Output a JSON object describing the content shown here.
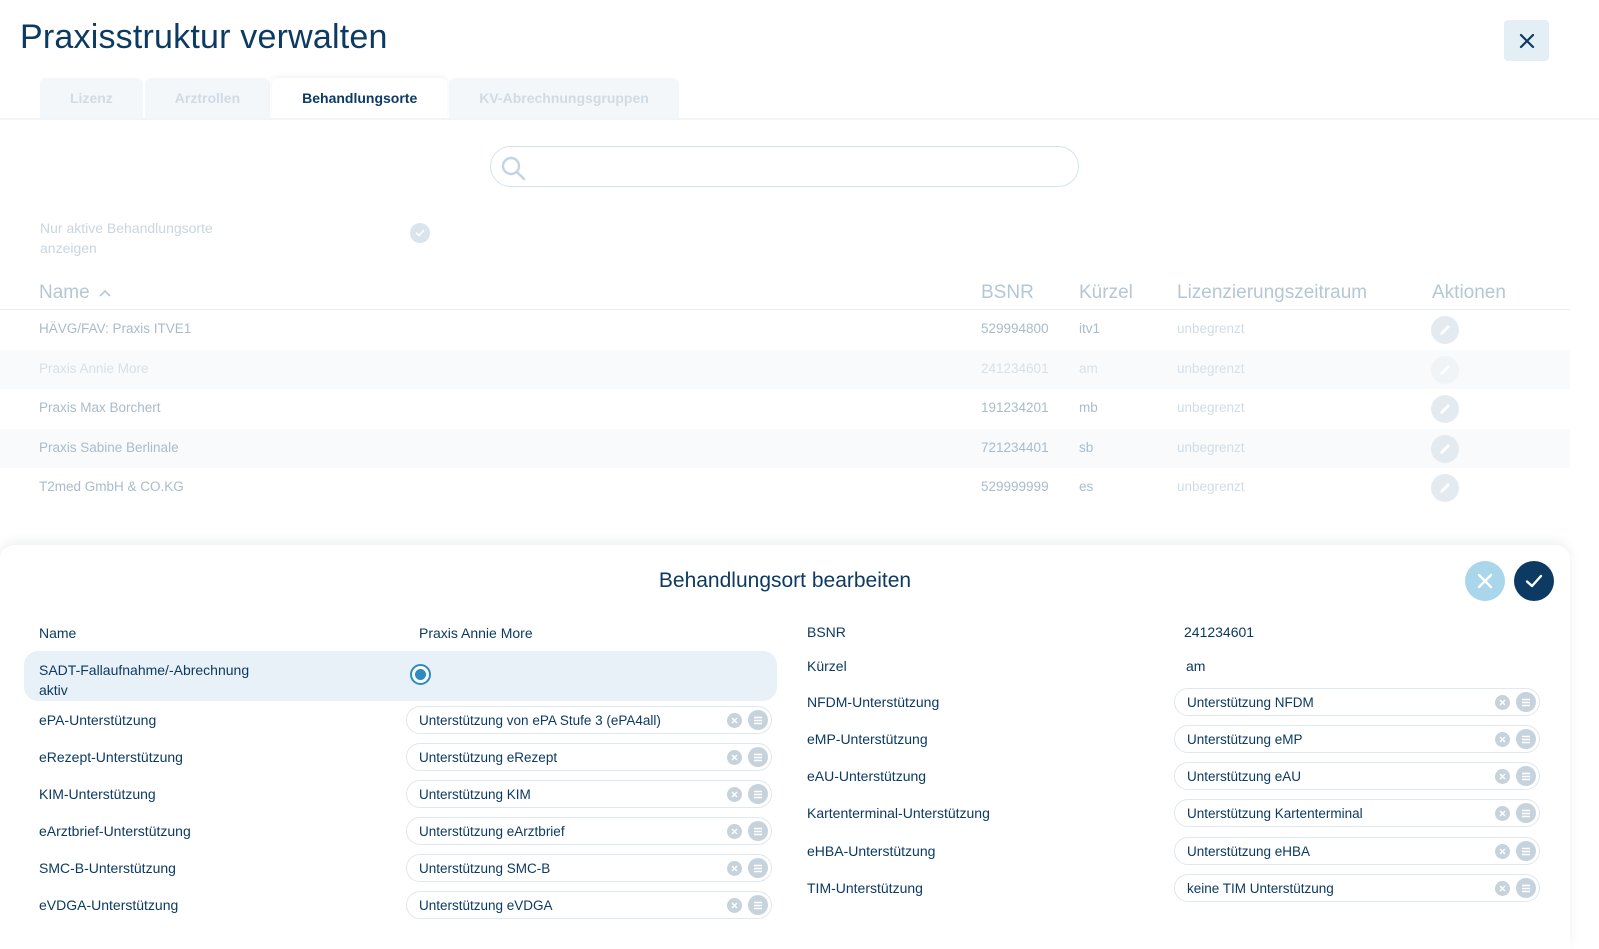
{
  "header": {
    "title": "Praxisstruktur verwalten"
  },
  "tabs": [
    {
      "label": "Lizenz"
    },
    {
      "label": "Arztrollen"
    },
    {
      "label": "Behandlungsorte"
    },
    {
      "label": "KV-Abrechnungsgruppen"
    }
  ],
  "active_tab": "Behandlungsorte",
  "search": {
    "value": "",
    "placeholder": ""
  },
  "filter": {
    "label": "Nur aktive Behandlungsorte anzeigen",
    "checked": true
  },
  "table": {
    "columns": {
      "name": "Name",
      "bsnr": "BSNR",
      "kuerzel": "Kürzel",
      "lizenz": "Lizenzierungszeitraum",
      "aktionen": "Aktionen"
    },
    "sort": "Name ascending",
    "rows": [
      {
        "name": "HÄVG/FAV: Praxis ITVE1",
        "bsnr": "529994800",
        "kuerzel": "itv1",
        "lizenz": "unbegrenzt"
      },
      {
        "name": "Praxis Annie More",
        "bsnr": "241234601",
        "kuerzel": "am",
        "lizenz": "unbegrenzt"
      },
      {
        "name": "Praxis Max Borchert",
        "bsnr": "191234201",
        "kuerzel": "mb",
        "lizenz": "unbegrenzt"
      },
      {
        "name": "Praxis Sabine Berlinale",
        "bsnr": "721234401",
        "kuerzel": "sb",
        "lizenz": "unbegrenzt"
      },
      {
        "name": "T2med GmbH & CO.KG",
        "bsnr": "529999999",
        "kuerzel": "es",
        "lizenz": "unbegrenzt"
      }
    ]
  },
  "edit_panel": {
    "title": "Behandlungsort bearbeiten",
    "left": {
      "name_label": "Name",
      "name_value": "Praxis Annie More",
      "sadt_label_1": "SADT-Fallaufnahme/-Abrechnung",
      "sadt_label_2": "aktiv",
      "sadt_checked": true,
      "fields": [
        {
          "label": "ePA-Unterstützung",
          "value": "Unterstützung von ePA Stufe 3 (ePA4all)"
        },
        {
          "label": "eRezept-Unterstützung",
          "value": "Unterstützung eRezept"
        },
        {
          "label": "KIM-Unterstützung",
          "value": "Unterstützung KIM"
        },
        {
          "label": "eArztbrief-Unterstützung",
          "value": "Unterstützung eArztbrief"
        },
        {
          "label": "SMC-B-Unterstützung",
          "value": "Unterstützung SMC-B"
        },
        {
          "label": "eVDGA-Unterstützung",
          "value": "Unterstützung eVDGA"
        }
      ]
    },
    "right": {
      "bsnr_label": "BSNR",
      "bsnr_value": "241234601",
      "kuerzel_label": "Kürzel",
      "kuerzel_value": "am",
      "fields": [
        {
          "label": "NFDM-Unterstützung",
          "value": "Unterstützung NFDM"
        },
        {
          "label": "eMP-Unterstützung",
          "value": "Unterstützung eMP"
        },
        {
          "label": "eAU-Unterstützung",
          "value": "Unterstützung eAU"
        },
        {
          "label": "Kartenterminal-Unterstützung",
          "value": "Unterstützung Kartenterminal"
        },
        {
          "label": "eHBA-Unterstützung",
          "value": "Unterstützung eHBA"
        },
        {
          "label": "TIM-Unterstützung",
          "value": "keine TIM Unterstützung"
        }
      ]
    }
  },
  "colors": {
    "primary": "#0c3a62",
    "accent": "#2d8bbf",
    "cancel": "#a9d6ea"
  }
}
